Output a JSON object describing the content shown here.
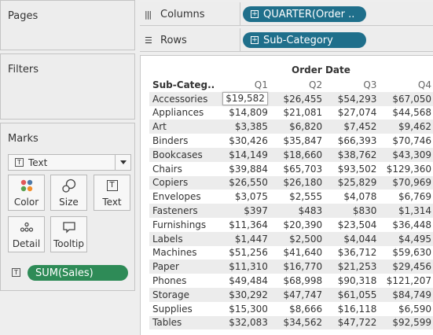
{
  "pages": {
    "title": "Pages"
  },
  "filters": {
    "title": "Filters"
  },
  "marks": {
    "title": "Marks",
    "mark_type": "Text",
    "buttons": {
      "color": "Color",
      "size": "Size",
      "text": "Text",
      "detail": "Detail",
      "tooltip": "Tooltip"
    },
    "pill": "SUM(Sales)"
  },
  "shelves": {
    "columns": {
      "label": "Columns",
      "pill": "QUARTER(Order .."
    },
    "rows": {
      "label": "Rows",
      "pill": "Sub-Category"
    }
  },
  "colors": {
    "pill_blue": "#1f6f8b",
    "pill_green": "#2e8b57",
    "band": "#ececec"
  },
  "view": {
    "column_header": "Order Date",
    "row_header": "Sub-Categ..",
    "quarters": [
      "Q1",
      "Q2",
      "Q3",
      "Q4"
    ],
    "rows": [
      {
        "cat": "Accessories",
        "v": [
          "$19,582",
          "$26,455",
          "$54,293",
          "$67,050"
        ]
      },
      {
        "cat": "Appliances",
        "v": [
          "$14,809",
          "$21,081",
          "$27,074",
          "$44,568"
        ]
      },
      {
        "cat": "Art",
        "v": [
          "$3,385",
          "$6,820",
          "$7,452",
          "$9,462"
        ]
      },
      {
        "cat": "Binders",
        "v": [
          "$30,426",
          "$35,847",
          "$66,393",
          "$70,746"
        ]
      },
      {
        "cat": "Bookcases",
        "v": [
          "$14,149",
          "$18,660",
          "$38,762",
          "$43,309"
        ]
      },
      {
        "cat": "Chairs",
        "v": [
          "$39,884",
          "$65,703",
          "$93,502",
          "$129,360"
        ]
      },
      {
        "cat": "Copiers",
        "v": [
          "$26,550",
          "$26,180",
          "$25,829",
          "$70,969"
        ]
      },
      {
        "cat": "Envelopes",
        "v": [
          "$3,075",
          "$2,555",
          "$4,078",
          "$6,769"
        ]
      },
      {
        "cat": "Fasteners",
        "v": [
          "$397",
          "$483",
          "$830",
          "$1,314"
        ]
      },
      {
        "cat": "Furnishings",
        "v": [
          "$11,364",
          "$20,390",
          "$23,504",
          "$36,448"
        ]
      },
      {
        "cat": "Labels",
        "v": [
          "$1,447",
          "$2,500",
          "$4,044",
          "$4,495"
        ]
      },
      {
        "cat": "Machines",
        "v": [
          "$51,256",
          "$41,640",
          "$36,712",
          "$59,630"
        ]
      },
      {
        "cat": "Paper",
        "v": [
          "$11,310",
          "$16,770",
          "$21,253",
          "$29,456"
        ]
      },
      {
        "cat": "Phones",
        "v": [
          "$49,484",
          "$68,998",
          "$90,318",
          "$121,207"
        ]
      },
      {
        "cat": "Storage",
        "v": [
          "$30,292",
          "$47,747",
          "$61,055",
          "$84,749"
        ]
      },
      {
        "cat": "Supplies",
        "v": [
          "$15,300",
          "$8,666",
          "$16,118",
          "$6,590"
        ]
      },
      {
        "cat": "Tables",
        "v": [
          "$32,083",
          "$34,562",
          "$47,722",
          "$92,599"
        ]
      }
    ]
  }
}
